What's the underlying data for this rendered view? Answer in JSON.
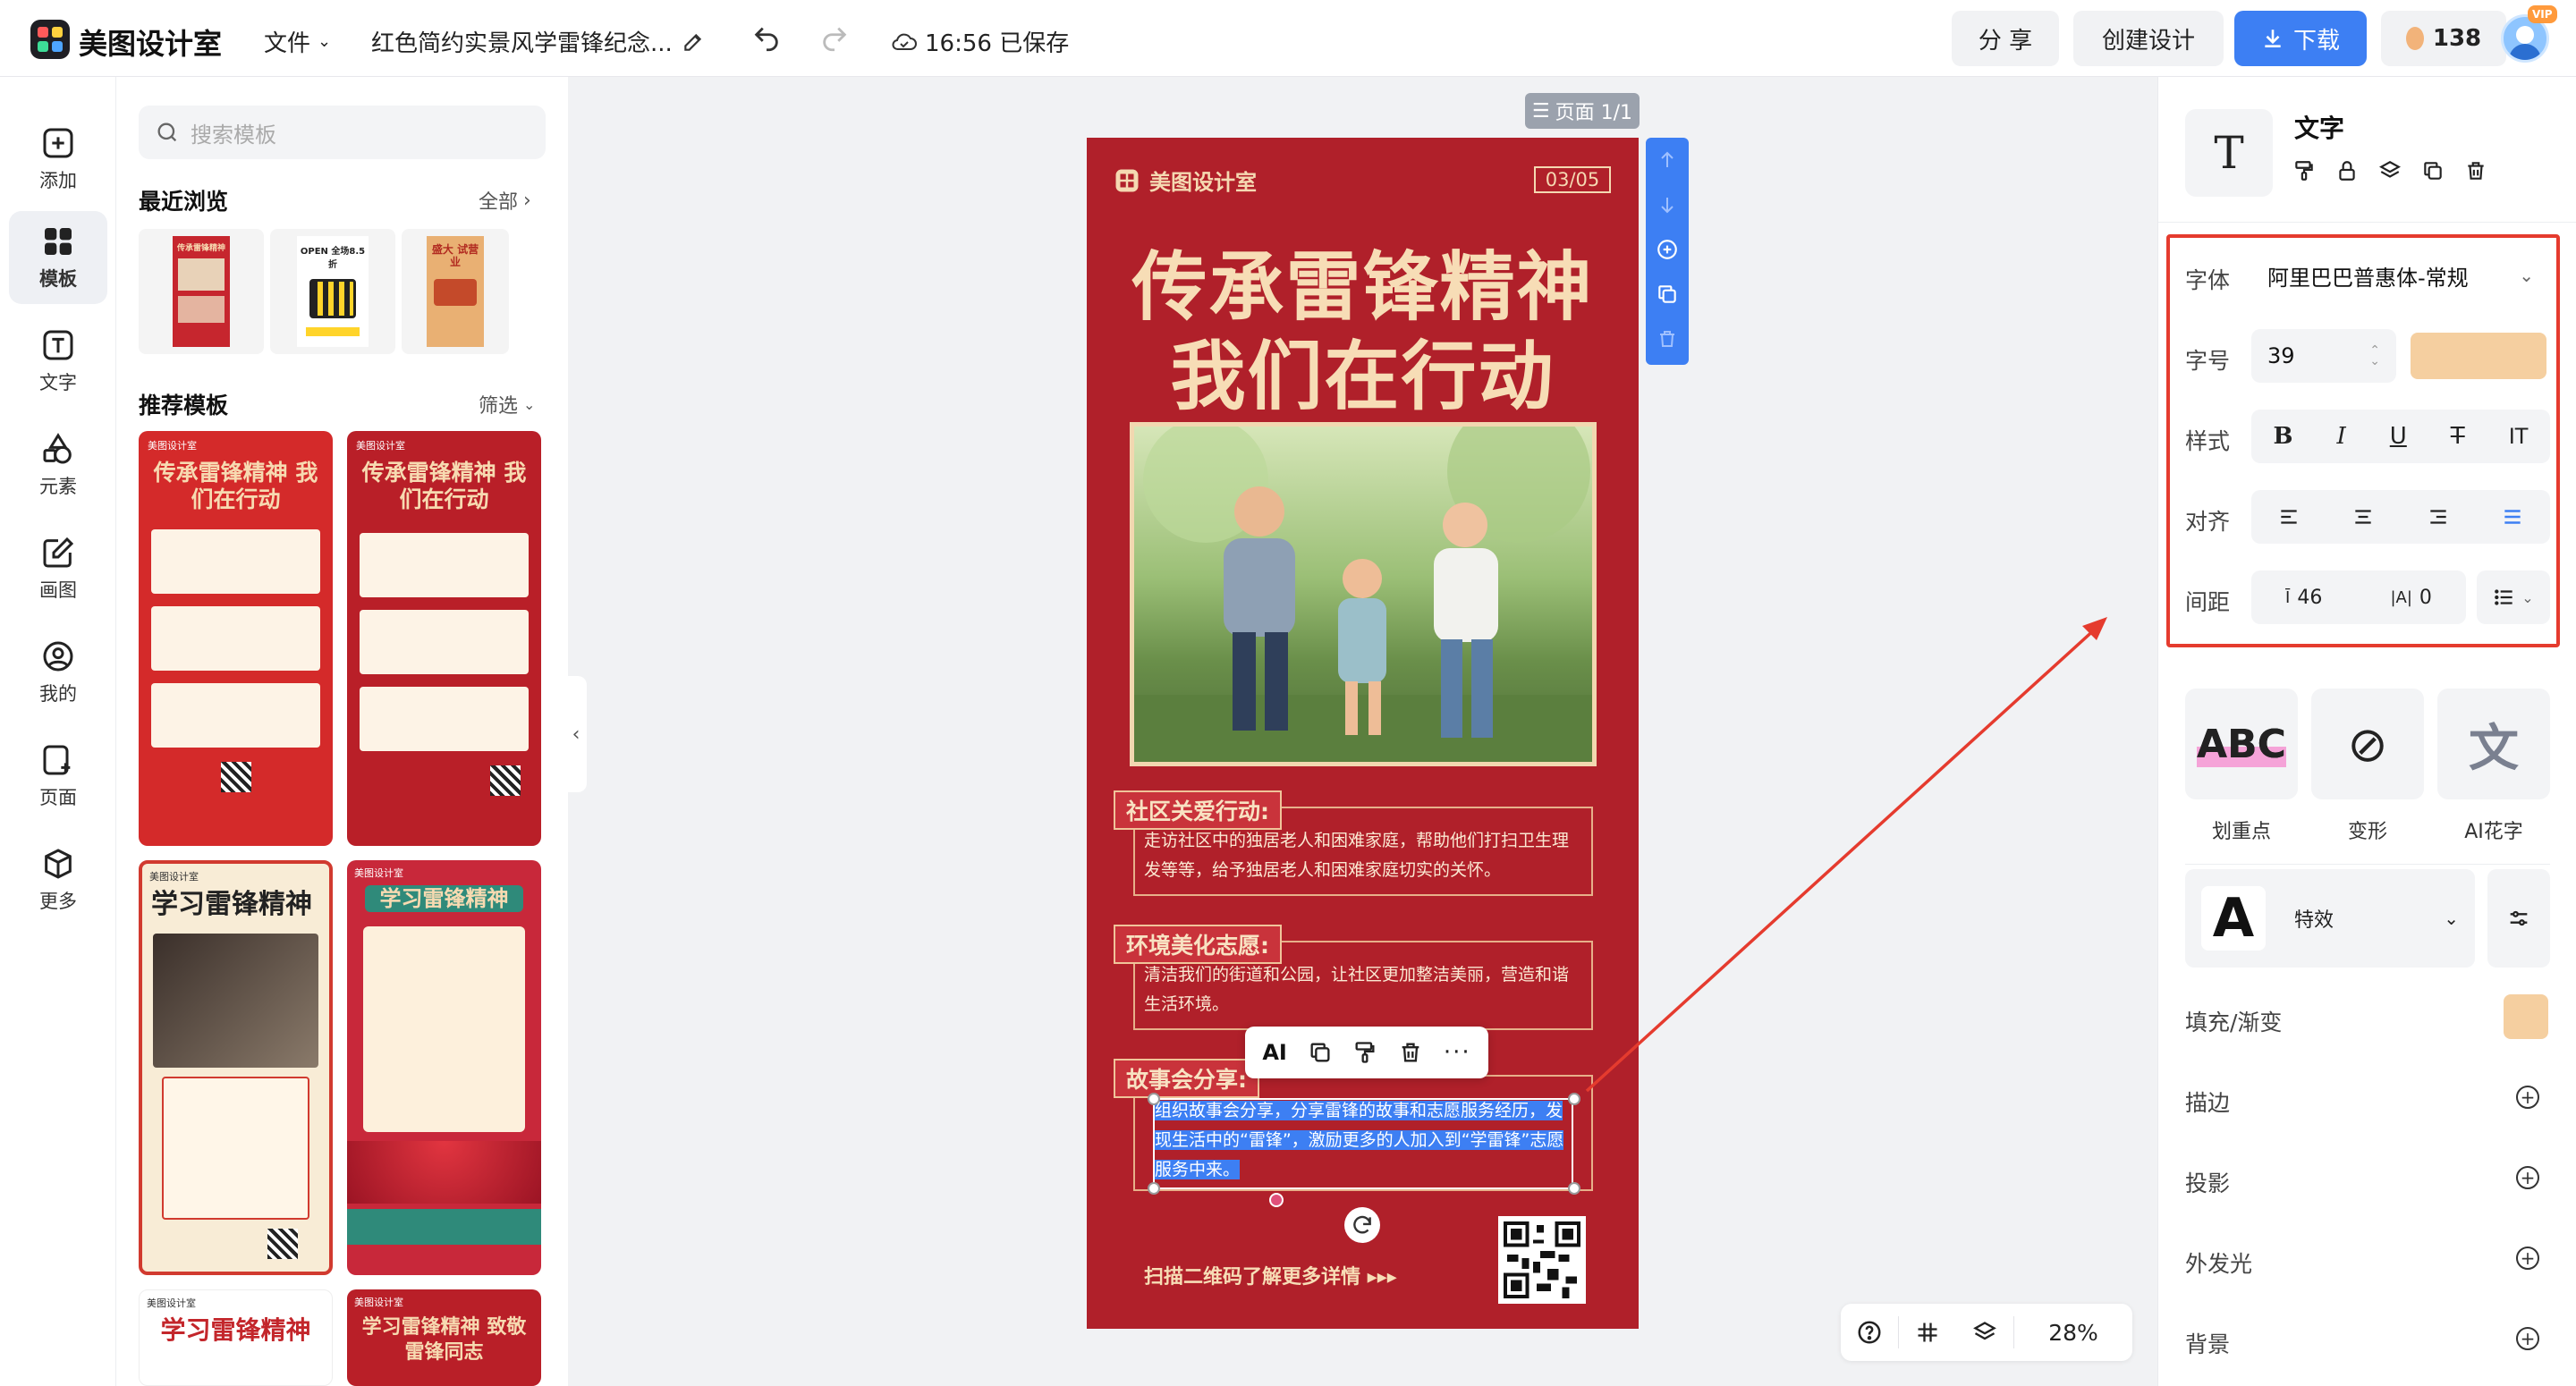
{
  "app": {
    "name": "美图设计室",
    "menu_file": "文件",
    "doc_title": "红色简约实景风学雷锋纪念...",
    "save_status": "16:56 已保存",
    "share_label": "分 享",
    "create_label": "创建设计",
    "download_label": "下载",
    "credits": "138",
    "vip_badge": "VIP",
    "brand_color": "#3d7ff3"
  },
  "rail": [
    {
      "label": "添加",
      "icon": "plus-square-icon"
    },
    {
      "label": "模板",
      "icon": "template-grid-icon"
    },
    {
      "label": "文字",
      "icon": "text-t-icon"
    },
    {
      "label": "元素",
      "icon": "shapes-icon"
    },
    {
      "label": "画图",
      "icon": "pencil-square-icon"
    },
    {
      "label": "我的",
      "icon": "user-circle-icon"
    },
    {
      "label": "页面",
      "icon": "page-add-icon"
    },
    {
      "label": "更多",
      "icon": "cube-icon"
    }
  ],
  "templates": {
    "search_placeholder": "搜索模板",
    "recent_title": "最近浏览",
    "recent_all": "全部",
    "recommend_title": "推荐模板",
    "filter_label": "筛选",
    "recent_thumbs": [
      {
        "caption": "传承雷锋精神"
      },
      {
        "caption": "OPEN 全场8.5折"
      },
      {
        "caption": "盛大 试营业"
      }
    ],
    "cards": [
      {
        "title": "传承雷锋精神 我们在行动",
        "brand": "美图设计室"
      },
      {
        "title": "传承雷锋精神 我们在行动",
        "brand": "美图设计室"
      },
      {
        "title": "学习雷锋精神",
        "brand": "美图设计室"
      },
      {
        "title": "学习雷锋精神",
        "brand": "美图设计室"
      },
      {
        "title": "学习雷锋精神",
        "brand": "美图设计室"
      },
      {
        "title": "学习雷锋精神 致敬雷锋同志",
        "brand": "美图设计室"
      }
    ]
  },
  "canvas": {
    "page_label": "页面 1/1",
    "zoom": "28%"
  },
  "poster": {
    "brand": "美图设计室",
    "date": "03/05",
    "title_line1": "传承雷锋精神",
    "title_line2": "我们在行动",
    "sections": [
      {
        "heading": "社区关爱行动:",
        "body": "走访社区中的独居老人和困难家庭，帮助他们打扫卫生理发等等，给予独居老人和困难家庭切实的关怀。"
      },
      {
        "heading": "环境美化志愿:",
        "body": "清洁我们的街道和公园，让社区更加整洁美丽，营造和谐生活环境。"
      },
      {
        "heading": "故事会分享:",
        "body": "组织故事会分享，分享雷锋的故事和志愿服务经历，发现生活中的“雷锋”，激励更多的人加入到“学雷锋”志愿服务中来。"
      }
    ],
    "footer": "扫描二维码了解更多详情 ▸▸▸",
    "bg_color": "#b0202a",
    "accent_color": "#f7ddb6"
  },
  "float_toolbar": {
    "ai_label": "AI"
  },
  "props": {
    "title": "文字",
    "font_label": "字体",
    "font_value": "阿里巴巴普惠体-常规",
    "size_label": "字号",
    "size_value": "39",
    "text_color": "#f5cfa0",
    "style_label": "样式",
    "align_label": "对齐",
    "spacing_label": "间距",
    "line_spacing": "46",
    "letter_spacing": "0",
    "effects": [
      {
        "label": "划重点",
        "glyph": "ABC"
      },
      {
        "label": "变形",
        "glyph": "⊘"
      },
      {
        "label": "AI花字",
        "glyph": "文"
      }
    ],
    "effect_preset": "特效",
    "fill_label": "填充/渐变",
    "stroke_label": "描边",
    "shadow_label": "投影",
    "glow_label": "外发光",
    "bg_label": "背景"
  }
}
